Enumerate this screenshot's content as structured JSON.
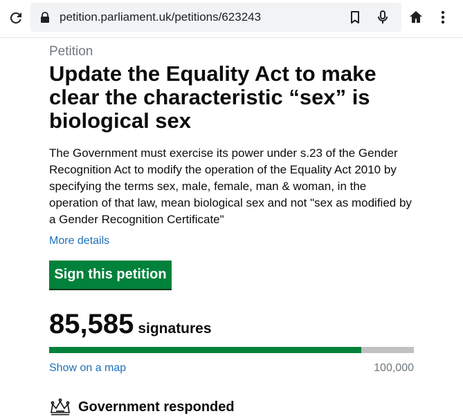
{
  "browser": {
    "url": "petition.parliament.uk/petitions/623243",
    "icons": [
      "reload-icon",
      "lock-icon",
      "bookmark-icon",
      "mic-icon",
      "home-icon",
      "more-vert-icon"
    ]
  },
  "petition": {
    "caption": "Petition",
    "title": "Update the Equality Act to make clear the characteristic “sex” is biological sex",
    "description": "The Government must exercise its power under s.23 of the Gender Recognition Act to modify the operation of the Equality Act 2010 by specifying the terms sex, male, female, man & woman, in the operation of that law, mean biological sex and not \"sex as modified by a Gender Recognition Certificate\"",
    "more_details": "More details",
    "sign_button": "Sign this petition",
    "signature_count": "85,585",
    "signature_label": "signatures",
    "progress_fraction": 0.85585,
    "show_map": "Show on a map",
    "goal": "100,000",
    "government_status": "Government responded"
  },
  "colors": {
    "accent_green": "#00823b",
    "link_blue": "#1d70b8",
    "secondary_text": "#6f777b",
    "progress_track": "#bfc1c3"
  }
}
